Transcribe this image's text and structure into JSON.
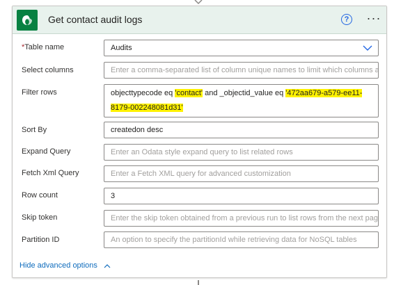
{
  "card": {
    "title": "Get contact audit logs",
    "help_icon": "help-circle-icon",
    "more_icon": "more-ellipsis-icon",
    "app_icon": "dataverse-icon",
    "accent_color": "#088142",
    "header_color": "#e8f2ed"
  },
  "fields": {
    "table_name": {
      "label": "Table name",
      "required_mark": "*",
      "value": "Audits"
    },
    "select_columns": {
      "label": "Select columns",
      "placeholder": "Enter a comma-separated list of column unique names to limit which columns a"
    },
    "filter_rows": {
      "label": "Filter rows",
      "text_1": "objecttypecode eq ",
      "hl_1": "'contact'",
      "text_2": " and _objectid_value eq ",
      "hl_2a": "'472aa679-a579-ee11-",
      "hl_2b": "8179-002248081d31'"
    },
    "sort_by": {
      "label": "Sort By",
      "value": "createdon desc"
    },
    "expand_query": {
      "label": "Expand Query",
      "placeholder": "Enter an Odata style expand query to list related rows"
    },
    "fetch_xml": {
      "label": "Fetch Xml Query",
      "placeholder": "Enter a Fetch XML query for advanced customization"
    },
    "row_count": {
      "label": "Row count",
      "value": "3"
    },
    "skip_token": {
      "label": "Skip token",
      "placeholder": "Enter the skip token obtained from a previous run to list rows from the next pag"
    },
    "partition_id": {
      "label": "Partition ID",
      "placeholder": "An option to specify the partitionId while retrieving data for NoSQL tables"
    }
  },
  "footer": {
    "hide_advanced_label": "Hide advanced options",
    "link_color": "#0f6cbd"
  },
  "highlight_color": "#fff200"
}
